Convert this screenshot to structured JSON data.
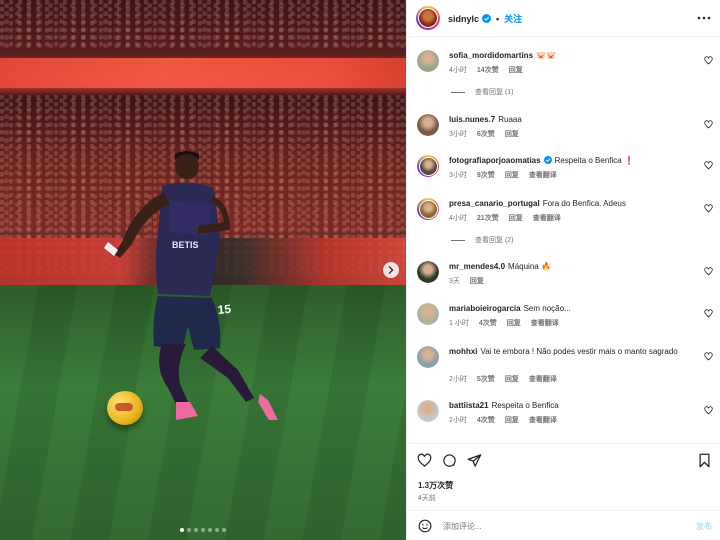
{
  "header": {
    "username": "sidnylc",
    "separator": "•",
    "follow_label": "关注",
    "verified": true
  },
  "comments": [
    {
      "username": "sofia_mordidomartins",
      "text": "🐷🐷",
      "time": "4小时",
      "likes": "14次赞",
      "reply": "回复",
      "view_replies": "查看回复 (1)",
      "avatar_color": "#9aa58a"
    },
    {
      "username": "luis.nunes.7",
      "text": "Ruaaa",
      "time": "3小时",
      "likes": "6次赞",
      "reply": "回复",
      "avatar_color": "#7b5a44"
    },
    {
      "username": "fotografiaporjoaomatias",
      "verified": true,
      "text": "Respeita o Benfica ❗",
      "time": "3小时",
      "likes": "9次赞",
      "reply": "回复",
      "translate": "查看翻译",
      "avatar_color": "#5a4a3a"
    },
    {
      "username": "presa_canario_portugal",
      "text": "Fora do Benfica. Adeus",
      "time": "4小时",
      "likes": "21次赞",
      "reply": "回复",
      "translate": "查看翻译",
      "view_replies": "查看回复 (2)",
      "avatar_color": "#8a6a30"
    },
    {
      "username": "mr_mendes4.0",
      "text": "Máquina 🔥",
      "time": "3天",
      "reply": "回复",
      "avatar_color": "#2d3a2a"
    },
    {
      "username": "mariaboieirogarcia",
      "text": "Sem noção...",
      "time": "1 小时",
      "likes": "4次赞",
      "reply": "回复",
      "translate": "查看翻译",
      "avatar_color": "#a8b59a"
    },
    {
      "username": "mohhxi",
      "text": "Vai te embora ! Não podes vestir mais o manto sagrado",
      "time": "2小时",
      "likes": "5次赞",
      "reply": "回复",
      "translate": "查看翻译",
      "avatar_color": "#8aa0a8"
    },
    {
      "username": "battiista21",
      "text": "Respeita o Benfica",
      "time": "2小时",
      "likes": "4次赞",
      "reply": "回复",
      "translate": "查看翻译",
      "avatar_color": "#c8c8c8"
    }
  ],
  "actions": {
    "likes": "1.3万次赞",
    "date": "4天前"
  },
  "composer": {
    "placeholder": "添加评论...",
    "post_label": "发布"
  },
  "carousel": {
    "total": 7,
    "active": 1
  },
  "colors": {
    "link_blue": "#0095f6",
    "muted": "#737373",
    "text": "#262626"
  }
}
